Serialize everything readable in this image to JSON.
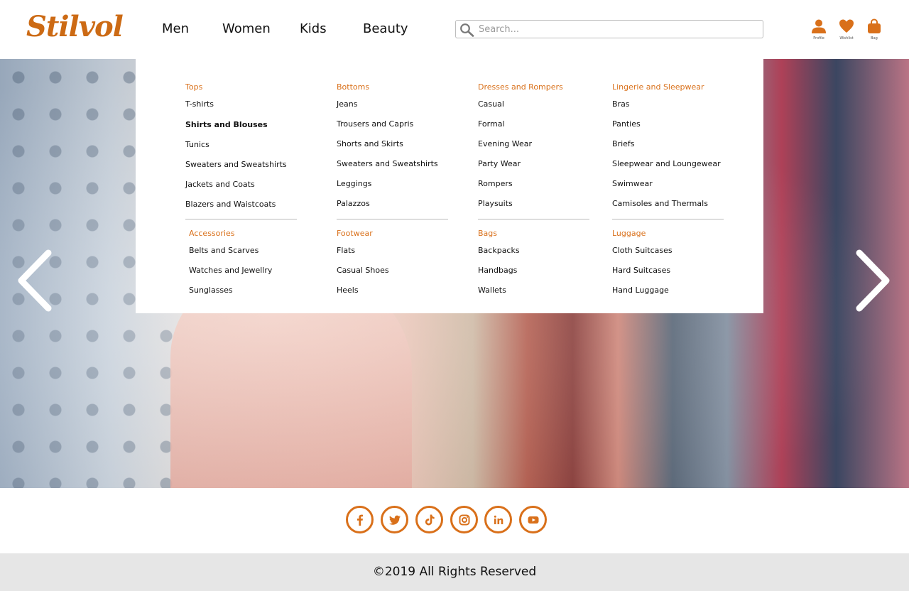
{
  "brand": {
    "logo_text": "Stilvol",
    "accent_color": "#d9701a"
  },
  "nav": {
    "items": [
      {
        "label": "Men"
      },
      {
        "label": "Women",
        "active": true
      },
      {
        "label": "Kids"
      },
      {
        "label": "Beauty"
      }
    ]
  },
  "search": {
    "placeholder": "Search...",
    "value": "",
    "icon": "search-icon"
  },
  "user_tools": [
    {
      "label": "Profile",
      "icon": "user-icon"
    },
    {
      "label": "Wishlist",
      "icon": "heart-icon"
    },
    {
      "label": "Bag",
      "icon": "shopping-bag-icon"
    }
  ],
  "carousel": {
    "prev_icon": "chevron-left-icon",
    "next_icon": "chevron-right-icon"
  },
  "mega_menu": {
    "columns": [
      {
        "groups": [
          {
            "title": "Tops",
            "links": [
              "T-shirts",
              "Shirts and Blouses",
              "Tunics",
              "Sweaters and Sweatshirts",
              "Jackets and Coats",
              "Blazers and Waistcoats"
            ],
            "highlighted": "Shirts and Blouses"
          },
          {
            "title": "Accessories",
            "links": [
              "Belts and Scarves",
              "Watches and Jewellry",
              "Sunglasses"
            ]
          }
        ]
      },
      {
        "groups": [
          {
            "title": "Bottoms",
            "links": [
              "Jeans",
              "Trousers and Capris",
              "Shorts and Skirts",
              "Sweaters and Sweatshirts",
              "Leggings",
              "Palazzos"
            ]
          },
          {
            "title": "Footwear",
            "links": [
              "Flats",
              "Casual Shoes",
              "Heels"
            ]
          }
        ]
      },
      {
        "groups": [
          {
            "title": "Dresses and Rompers",
            "links": [
              "Casual",
              "Formal",
              "Evening Wear",
              "Party Wear",
              "Rompers",
              "Playsuits"
            ]
          },
          {
            "title": "Bags",
            "links": [
              "Backpacks",
              "Handbags",
              "Wallets"
            ]
          }
        ]
      },
      {
        "groups": [
          {
            "title": "Lingerie and Sleepwear",
            "links": [
              "Bras",
              "Panties",
              "Briefs",
              "Sleepwear and Loungewear",
              "Swimwear",
              "Camisoles and Thermals"
            ]
          },
          {
            "title": "Luggage",
            "links": [
              "Cloth Suitcases",
              "Hard Suitcases",
              "Hand Luggage"
            ]
          }
        ]
      }
    ]
  },
  "social": [
    {
      "icon": "facebook-icon"
    },
    {
      "icon": "twitter-icon"
    },
    {
      "icon": "tiktok-icon"
    },
    {
      "icon": "instagram-icon"
    },
    {
      "icon": "linkedin-icon"
    },
    {
      "icon": "youtube-icon"
    }
  ],
  "footer": {
    "copyright": "©2019 All Rights Reserved"
  }
}
